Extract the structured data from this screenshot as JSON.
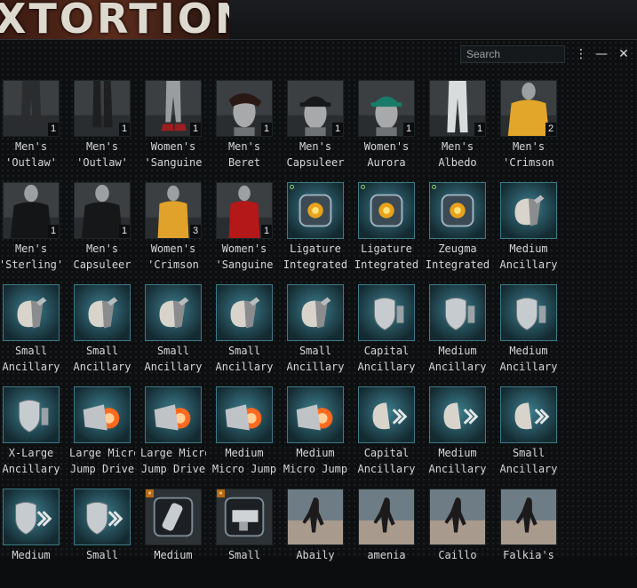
{
  "banner": {
    "text": "XTORTION"
  },
  "window": {
    "search_placeholder": "Search",
    "menu_icon": "more-vertical-icon",
    "minimize_icon": "minimize-icon",
    "close_icon": "close-icon"
  },
  "items": [
    {
      "l1": "Men's",
      "l2": "'Outlaw'",
      "qty": "1",
      "kind": "pants",
      "tone": "#2a2c2e"
    },
    {
      "l1": "Men's",
      "l2": "'Outlaw'",
      "qty": "1",
      "kind": "boots",
      "tone": "#1d1f20"
    },
    {
      "l1": "Women's",
      "l2": "'Sanguine",
      "qty": "1",
      "kind": "legs",
      "tone": "#8a8d90"
    },
    {
      "l1": "Men's",
      "l2": "Beret",
      "qty": "1",
      "kind": "beret",
      "tone": "#2a1815"
    },
    {
      "l1": "Men's",
      "l2": "Capsuleer",
      "qty": "1",
      "kind": "cap",
      "tone": "#16181a"
    },
    {
      "l1": "Women's",
      "l2": "Aurora",
      "qty": "1",
      "kind": "cap",
      "tone": "#1a7b6a"
    },
    {
      "l1": "Men's",
      "l2": "Albedo",
      "qty": "1",
      "kind": "pantswhite",
      "tone": "#d9dcdd"
    },
    {
      "l1": "Men's",
      "l2": "'Crimson",
      "qty": "2",
      "kind": "shirt",
      "tone": "#e2a62a"
    },
    {
      "l1": "Men's",
      "l2": "'Sterling'",
      "qty": "1",
      "kind": "shirt",
      "tone": "#141516"
    },
    {
      "l1": "Men's",
      "l2": "Capsuleer",
      "qty": "1",
      "kind": "shirt",
      "tone": "#161718"
    },
    {
      "l1": "Women's",
      "l2": "'Crimson",
      "qty": "3",
      "kind": "womanshirt",
      "tone": "#e0a22a"
    },
    {
      "l1": "Women's",
      "l2": "'Sanguine",
      "qty": "1",
      "kind": "womanshirt",
      "tone": "#b51818"
    },
    {
      "l1": "Ligature",
      "l2": "Integrated",
      "qty": "",
      "kind": "analyzer",
      "dot": true
    },
    {
      "l1": "Ligature",
      "l2": "Integrated",
      "qty": "",
      "kind": "analyzer",
      "dot": true
    },
    {
      "l1": "Zeugma",
      "l2": "Integrated",
      "qty": "",
      "kind": "analyzer",
      "dot": true
    },
    {
      "l1": "Medium",
      "l2": "Ancillary",
      "qty": "",
      "kind": "repairer"
    },
    {
      "l1": "Small",
      "l2": "Ancillary",
      "qty": "",
      "kind": "repairer"
    },
    {
      "l1": "Small",
      "l2": "Ancillary",
      "qty": "",
      "kind": "repairer"
    },
    {
      "l1": "Small",
      "l2": "Ancillary",
      "qty": "",
      "kind": "repairer"
    },
    {
      "l1": "Small",
      "l2": "Ancillary",
      "qty": "",
      "kind": "repairer"
    },
    {
      "l1": "Small",
      "l2": "Ancillary",
      "qty": "",
      "kind": "repairer"
    },
    {
      "l1": "Capital",
      "l2": "Ancillary",
      "qty": "",
      "kind": "shield"
    },
    {
      "l1": "Medium",
      "l2": "Ancillary",
      "qty": "",
      "kind": "shield"
    },
    {
      "l1": "Medium",
      "l2": "Ancillary",
      "qty": "",
      "kind": "shield"
    },
    {
      "l1": "X-Large",
      "l2": "Ancillary",
      "qty": "",
      "kind": "shield"
    },
    {
      "l1": "Large Micro",
      "l2": "Jump Drive",
      "qty": "",
      "kind": "drive"
    },
    {
      "l1": "Large Micro",
      "l2": "Jump Drive",
      "qty": "",
      "kind": "drive"
    },
    {
      "l1": "Medium",
      "l2": "Micro Jump",
      "qty": "",
      "kind": "drive"
    },
    {
      "l1": "Medium",
      "l2": "Micro Jump",
      "qty": "",
      "kind": "drive"
    },
    {
      "l1": "Capital",
      "l2": "Ancillary",
      "qty": "",
      "kind": "armorchev"
    },
    {
      "l1": "Medium",
      "l2": "Ancillary",
      "qty": "",
      "kind": "armorchev"
    },
    {
      "l1": "Small",
      "l2": "Ancillary",
      "qty": "",
      "kind": "armorchev"
    },
    {
      "l1": "Medium",
      "l2": "",
      "qty": "",
      "kind": "shieldchev"
    },
    {
      "l1": "Small",
      "l2": "",
      "qty": "",
      "kind": "shieldchev"
    },
    {
      "l1": "Medium",
      "l2": "",
      "qty": "",
      "kind": "canister",
      "tag": true
    },
    {
      "l1": "Small",
      "l2": "",
      "qty": "",
      "kind": "gun",
      "tag": true
    },
    {
      "l1": "Abaily",
      "l2": "",
      "qty": "",
      "kind": "portrait"
    },
    {
      "l1": "amenia",
      "l2": "",
      "qty": "",
      "kind": "portrait"
    },
    {
      "l1": "Caillo",
      "l2": "",
      "qty": "",
      "kind": "portrait"
    },
    {
      "l1": "Falkia's",
      "l2": "",
      "qty": "",
      "kind": "portrait"
    }
  ]
}
